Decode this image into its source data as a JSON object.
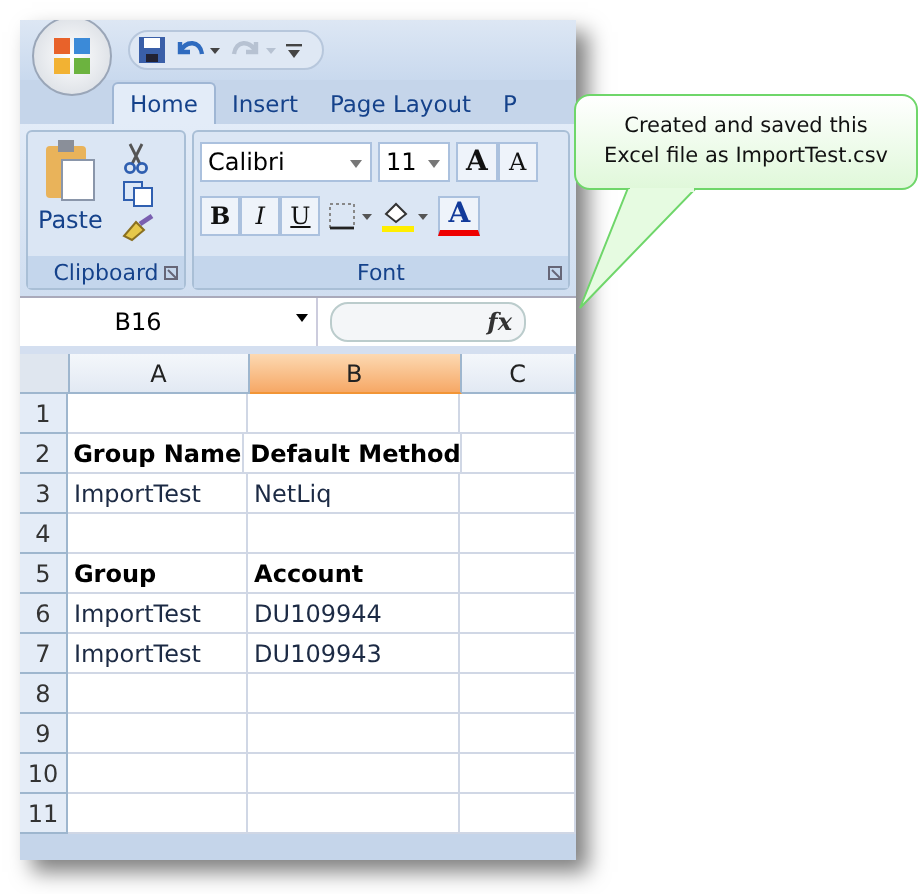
{
  "tabs": [
    {
      "label": "Home",
      "selected": true
    },
    {
      "label": "Insert",
      "selected": false
    },
    {
      "label": "Page Layout",
      "selected": false
    },
    {
      "label": "P",
      "selected": false
    }
  ],
  "clipboard": {
    "paste_label": "Paste",
    "group_label": "Clipboard"
  },
  "font": {
    "family": "Calibri",
    "size": "11",
    "grow_label": "A",
    "shrink_label": "A",
    "bold_label": "B",
    "italic_label": "I",
    "underline_label": "U",
    "color_label": "A",
    "group_label": "Font"
  },
  "formula_bar": {
    "name_box": "B16",
    "function_label": "fx"
  },
  "columns": [
    {
      "label": "A",
      "selected": false
    },
    {
      "label": "B",
      "selected": true
    },
    {
      "label": "C",
      "selected": false
    }
  ],
  "rows": [
    {
      "label": "1",
      "cells": []
    },
    {
      "label": "2",
      "cells": [
        {
          "text": "Group Name",
          "bold": true
        },
        {
          "text": "Default Method",
          "bold": true
        }
      ]
    },
    {
      "label": "3",
      "cells": [
        {
          "text": "ImportTest",
          "bold": false
        },
        {
          "text": "NetLiq",
          "bold": false
        }
      ]
    },
    {
      "label": "4",
      "cells": []
    },
    {
      "label": "5",
      "cells": [
        {
          "text": "Group",
          "bold": true
        },
        {
          "text": "Account",
          "bold": true
        }
      ]
    },
    {
      "label": "6",
      "cells": [
        {
          "text": "ImportTest",
          "bold": false
        },
        {
          "text": "DU109944",
          "bold": false
        }
      ]
    },
    {
      "label": "7",
      "cells": [
        {
          "text": "ImportTest",
          "bold": false
        },
        {
          "text": "DU109943",
          "bold": false
        }
      ]
    },
    {
      "label": "8",
      "cells": []
    },
    {
      "label": "9",
      "cells": []
    },
    {
      "label": "10",
      "cells": []
    },
    {
      "label": "11",
      "cells": []
    }
  ],
  "callout": {
    "text": "Created and saved this Excel file as ImportTest.csv"
  }
}
